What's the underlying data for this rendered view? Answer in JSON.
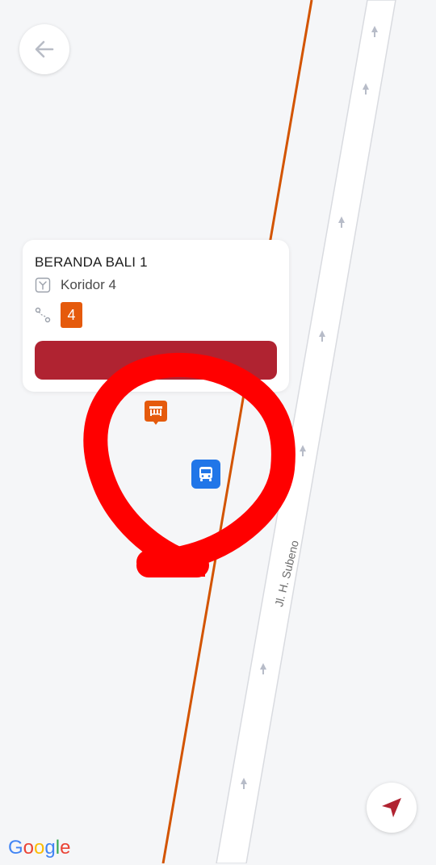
{
  "map": {
    "street_name": "Jl. H. Subeno",
    "road_color": "#ffffff",
    "route_line_color": "#d35400",
    "background_color": "#f5f6f8"
  },
  "back_button": {
    "icon": "arrow-left-icon"
  },
  "stop_card": {
    "title": "BERANDA BALI 1",
    "corridor_label": "Koridor 4",
    "corridor_icon": "corridor-icon",
    "route_icon": "route-icon",
    "route_badge": "4",
    "route_badge_color": "#e55a0c",
    "action_button_label": "",
    "action_button_color": "#b02331"
  },
  "markers": {
    "stop_icon": "bus-stop-icon",
    "bus_icon": "bus-icon",
    "stop_color": "#e55a0c",
    "bus_color": "#2176e8"
  },
  "locate_button": {
    "icon": "navigation-arrow-icon",
    "color": "#b02331"
  },
  "attribution": {
    "logo_text": "Google"
  },
  "annotation": {
    "color": "#ff0000",
    "shape": "hand-drawn circle"
  }
}
